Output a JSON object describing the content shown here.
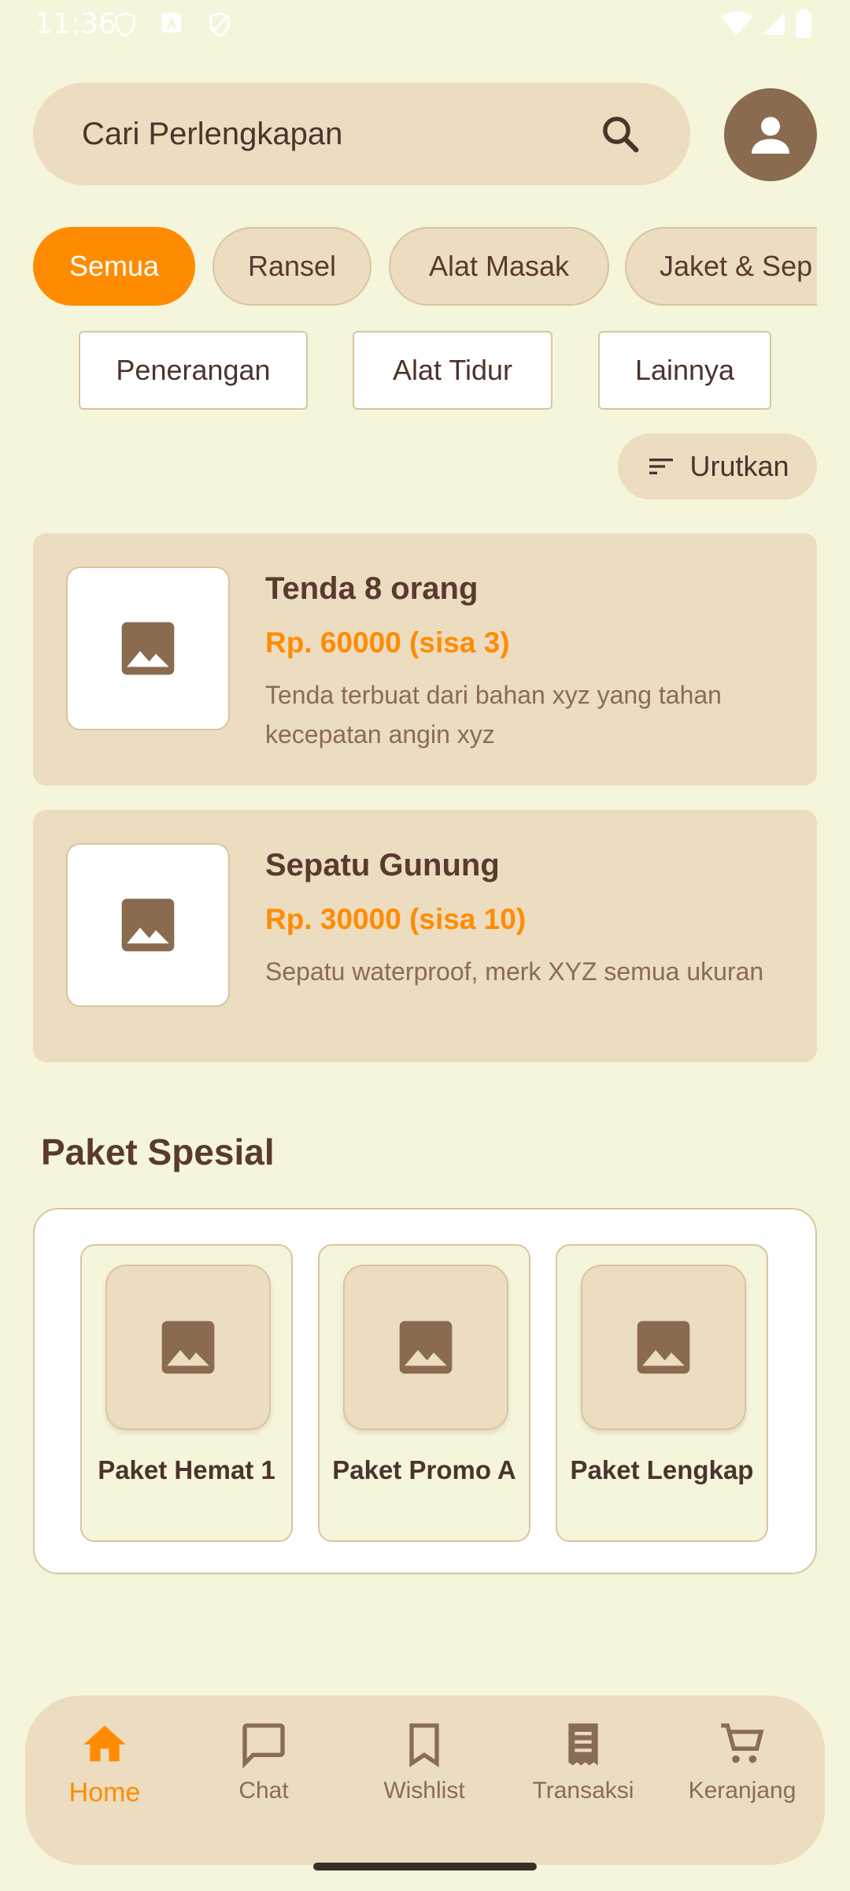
{
  "status_bar": {
    "time": "11:36"
  },
  "search": {
    "placeholder": "Cari Perlengkapan"
  },
  "categories": {
    "primary": [
      "Semua",
      "Ransel",
      "Alat Masak",
      "Jaket & Sep"
    ],
    "secondary": [
      "Penerangan",
      "Alat Tidur",
      "Lainnya"
    ],
    "active": "Semua"
  },
  "sort": {
    "label": "Urutkan"
  },
  "products": [
    {
      "name": "Tenda 8 orang",
      "price": "Rp. 60000 (sisa 3)",
      "description": "Tenda terbuat dari bahan xyz yang tahan kecepatan angin xyz"
    },
    {
      "name": "Sepatu Gunung",
      "price": "Rp. 30000 (sisa 10)",
      "description": "Sepatu waterproof, merk XYZ semua ukuran"
    }
  ],
  "special": {
    "title": "Paket Spesial",
    "bundles": [
      {
        "name": "Paket Hemat 1"
      },
      {
        "name": "Paket Promo A"
      },
      {
        "name": "Paket Lengkap"
      }
    ]
  },
  "nav": {
    "items": [
      {
        "label": "Home",
        "icon": "home-icon"
      },
      {
        "label": "Chat",
        "icon": "chat-icon"
      },
      {
        "label": "Wishlist",
        "icon": "bookmark-icon"
      },
      {
        "label": "Transaksi",
        "icon": "receipt-icon"
      },
      {
        "label": "Keranjang",
        "icon": "cart-icon"
      }
    ],
    "active": "Home"
  },
  "colors": {
    "background": "#f5f5dc",
    "surface": "#ecdcc0",
    "accent": "#ff8c00",
    "text": "#5a3a2e",
    "icon_brown": "#8a6b4f"
  }
}
